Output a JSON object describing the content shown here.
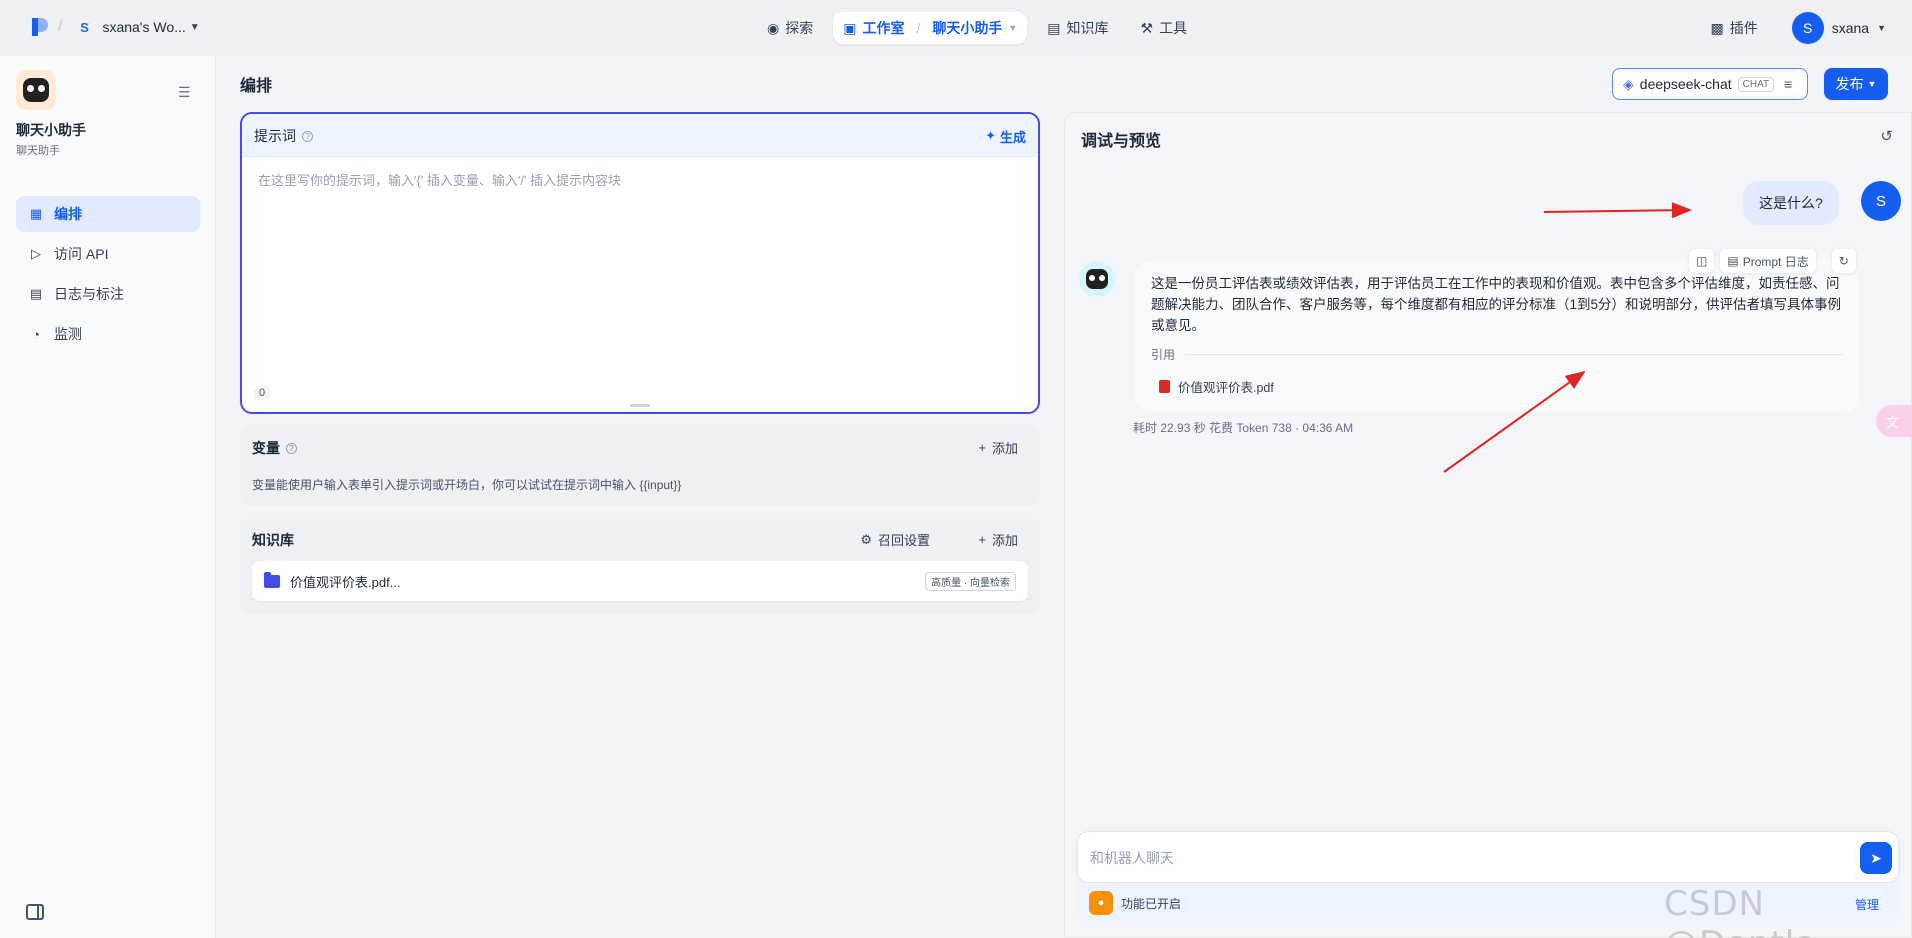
{
  "topbar": {
    "workspace_initial": "S",
    "workspace_name": "sxana's Wo...",
    "nav": {
      "explore": "探索",
      "studio": "工作室",
      "current_app": "聊天小助手",
      "knowledge": "知识库",
      "tools": "工具"
    },
    "plugins": "插件",
    "user_initial": "S",
    "user_name": "sxana"
  },
  "sidebar": {
    "app_name": "聊天小助手",
    "app_type": "聊天助手",
    "items": [
      {
        "label": "编排",
        "icon": "layout-icon",
        "active": true
      },
      {
        "label": "访问 API",
        "icon": "terminal-icon",
        "active": false
      },
      {
        "label": "日志与标注",
        "icon": "file-text-icon",
        "active": false
      },
      {
        "label": "监测",
        "icon": "gauge-icon",
        "active": false
      }
    ]
  },
  "editor": {
    "title": "编排",
    "model": {
      "name": "deepseek-chat",
      "badge": "CHAT"
    },
    "publish": "发布",
    "prompt": {
      "title": "提示词",
      "generate": "生成",
      "placeholder": "在这里写你的提示词，输入'{' 插入变量、输入'/' 插入提示内容块",
      "count": "0"
    },
    "variables": {
      "title": "变量",
      "add": "添加",
      "description": "变量能使用户输入表单引入提示词或开场白，你可以试试在提示词中输入 {{input}}"
    },
    "knowledge": {
      "title": "知识库",
      "recall_settings": "召回设置",
      "add": "添加",
      "items": [
        {
          "name": "价值观评价表.pdf...",
          "tag": "高质量 · 向量检索"
        }
      ]
    }
  },
  "debug": {
    "title": "调试与预览",
    "user_message": "这是什么?",
    "user_initial": "S",
    "bot_message": "这是一份员工评估表或绩效评估表，用于评估员工在工作中的表现和价值观。表中包含多个评估维度，如责任感、问题解决能力、团队合作、客户服务等，每个维度都有相应的评分标准（1到5分）和说明部分，供评估者填写具体事例或意见。",
    "citation_label": "引用",
    "citation_file": "价值观评价表.pdf",
    "prompt_log": "Prompt 日志",
    "meta": "耗时 22.93 秒  花费 Token 738  ·  04:36 AM",
    "input_placeholder": "和机器人聊天",
    "feature_label": "功能已开启",
    "manage": "管理"
  },
  "watermark": "CSDN @Dontla",
  "colors": {
    "primary": "#155eef",
    "prompt_border": "#444ce7",
    "annotation_arrow": "#e02424"
  }
}
